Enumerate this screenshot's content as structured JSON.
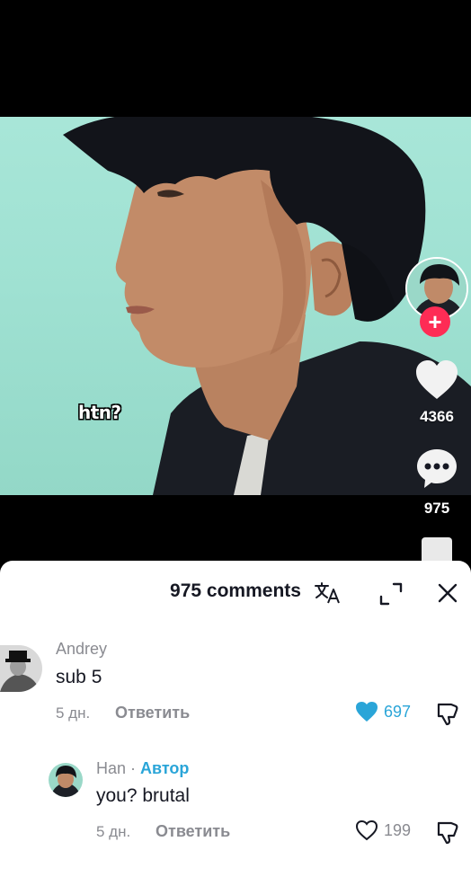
{
  "video": {
    "caption": "htn?",
    "like_count": "4366",
    "comment_count": "975"
  },
  "comments_sheet": {
    "title": "975 comments",
    "icons": [
      "translate-icon",
      "expand-icon",
      "close-icon"
    ],
    "comments": [
      {
        "username": "Andrey",
        "text": "sub 5",
        "time": "5 дн.",
        "reply_label": "Ответить",
        "likes": "697",
        "liked": true
      },
      {
        "username": "Han",
        "separator": " · ",
        "author_badge": "Автор",
        "text": "you? brutal",
        "time": "5 дн.",
        "reply_label": "Ответить",
        "likes": "199",
        "liked": false
      }
    ]
  },
  "colors": {
    "accent_red": "#fe2c55",
    "liked_blue": "#2aa5d8",
    "author_blue": "#2aa5d8"
  }
}
